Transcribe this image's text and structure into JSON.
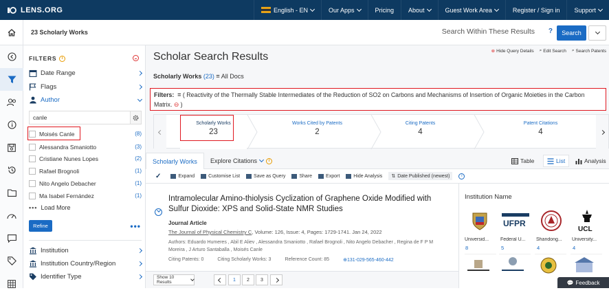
{
  "topbar": {
    "brand": "LENS.ORG",
    "language": "English - EN",
    "nav": [
      "Our Apps",
      "Pricing",
      "About",
      "Guest Work Area",
      "Register / Sign in",
      "Support"
    ]
  },
  "subbar": {
    "works_count": "23 Scholarly Works",
    "search_placeholder": "Search Within These Results",
    "help": "?",
    "search_button": "Search"
  },
  "filters": {
    "title": "FILTERS",
    "sections": [
      {
        "label": "Date Range"
      },
      {
        "label": "Flags"
      },
      {
        "label": "Author"
      }
    ],
    "author_search": "canle",
    "authors": [
      {
        "name": "Moisés Canle",
        "count": "(8)"
      },
      {
        "name": "Alessandra Smaniotto",
        "count": "(3)"
      },
      {
        "name": "Cristiane Nunes Lopes",
        "count": "(2)"
      },
      {
        "name": "Rafael Brognoli",
        "count": "(1)"
      },
      {
        "name": "Nito Angelo Debacher",
        "count": "(1)"
      },
      {
        "name": "Ma Isabel Fernández",
        "count": "(1)"
      }
    ],
    "load_more": "Load More",
    "refine": "Refine",
    "more_sections": [
      {
        "label": "Institution"
      },
      {
        "label": "Institution Country/Region"
      },
      {
        "label": "Identifier Type"
      }
    ]
  },
  "main": {
    "title": "Scholar Search Results",
    "tools": [
      "Hide Query Details",
      "Edit Search",
      "Search Patents"
    ],
    "crumb_label": "Scholarly Works",
    "crumb_count": "(23)",
    "crumb_sep": "=",
    "crumb_value": "All Docs",
    "filter_label": "Filters:",
    "filter_eq": "=",
    "filter_text": "Reactivity of the Thermally Stable Intermediates of the Reduction of SO2 on Carbons and Mechanisms of Insertion of Organic Moieties in the Carbon Matrix.",
    "metrics": [
      {
        "label": "Scholarly Works",
        "value": "23"
      },
      {
        "label": "Works Cited by Patents",
        "value": "2"
      },
      {
        "label": "Citing Patents",
        "value": "4"
      },
      {
        "label": "Patent Citations",
        "value": "4"
      }
    ],
    "tabs": [
      "Scholarly Works",
      "Explore Citations"
    ],
    "views": [
      "Table",
      "List",
      "Analysis"
    ],
    "toolbar": [
      "Expand",
      "Customise List",
      "Save as Query",
      "Share",
      "Export",
      "Hide Analysis",
      "Date Published (newest)"
    ]
  },
  "result": {
    "title": "Intramolecular Amino-thiolysis Cyclization of Graphene Oxide Modified with Sulfur Dioxide: XPS and Solid-State NMR Studies",
    "type": "Journal Article",
    "journal": "The Journal of Physical Chemistry C",
    "details": ",  Volume: 126,  Issue: 4,  Pages: 1729-1741.  Jan 24, 2022",
    "authors": "Authors: Eduardo Humeres , Abil E Aliev , Alessandra Smaniotto , Rafael Brognoli , Nito Angelo Debacher , Regina de F P M Moreira , J Arturo Santaballa , Moisés Canle",
    "citing_patents": "Citing Patents: 0",
    "citing_works": "Citing Scholarly Works: 3",
    "reference_count": "Reference Count: 85",
    "doi": "131-029-565-460-442"
  },
  "pager": {
    "per_page": "Show 10 Results",
    "pages": [
      "1",
      "2",
      "3"
    ]
  },
  "institutions": {
    "title": "Institution Name",
    "items": [
      {
        "name": "Universid...",
        "count": "8"
      },
      {
        "name": "Federal U...",
        "count": "5"
      },
      {
        "name": "Shandong...",
        "count": "4"
      },
      {
        "name": "University...",
        "count": "4"
      }
    ]
  },
  "feedback": "Feedback",
  "colors": {
    "navy": "#0e3a61",
    "accent": "#1a6bc4",
    "highlight": "#e0171f"
  }
}
